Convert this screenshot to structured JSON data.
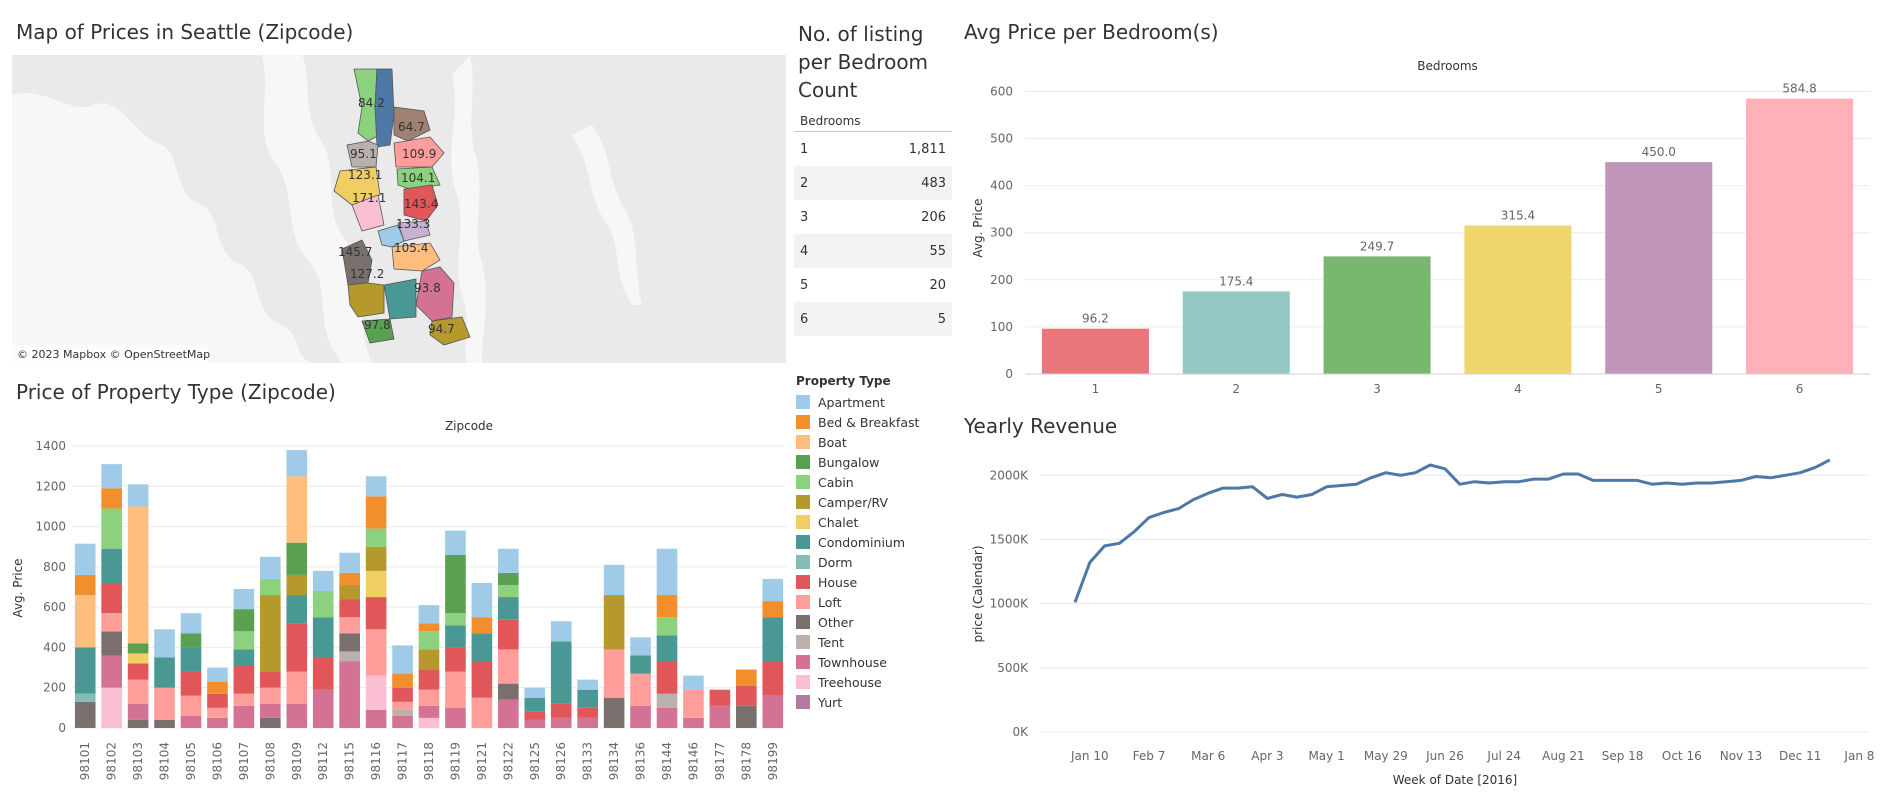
{
  "titles": {
    "map": "Map of Prices in Seattle (Zipcode)",
    "listing": [
      "No. of listing",
      "per Bedroom",
      "Count"
    ],
    "avg_bed": "Avg Price per Bedroom(s)",
    "prop_type": "Price of Property Type (Zipcode)",
    "revenue": "Yearly Revenue"
  },
  "map": {
    "attribution": "© 2023 Mapbox © OpenStreetMap",
    "labels": [
      "84.2",
      "64.7",
      "95.1",
      "109.9",
      "123.1",
      "104.1",
      "171.1",
      "143.4",
      "133.3",
      "145.7",
      "105.4",
      "127.2",
      "93.8",
      "97.8",
      "94.7"
    ],
    "colors": {
      "water": "#ffffff",
      "land": "#e8e8e8"
    }
  },
  "listing_table": {
    "header": "Bedrooms",
    "rows": [
      {
        "bedrooms": "1",
        "count": "1,811"
      },
      {
        "bedrooms": "2",
        "count": "483"
      },
      {
        "bedrooms": "3",
        "count": "206"
      },
      {
        "bedrooms": "4",
        "count": "55"
      },
      {
        "bedrooms": "5",
        "count": "20"
      },
      {
        "bedrooms": "6",
        "count": "5"
      }
    ]
  },
  "legend": {
    "title": "Property Type",
    "items": [
      {
        "name": "Apartment",
        "color": "#a0cbe8"
      },
      {
        "name": "Bed & Breakfast",
        "color": "#f28e2b"
      },
      {
        "name": "Boat",
        "color": "#ffbe7d"
      },
      {
        "name": "Bungalow",
        "color": "#59a14f"
      },
      {
        "name": "Cabin",
        "color": "#8cd17d"
      },
      {
        "name": "Camper/RV",
        "color": "#b6992d"
      },
      {
        "name": "Chalet",
        "color": "#f1ce63"
      },
      {
        "name": "Condominium",
        "color": "#499894"
      },
      {
        "name": "Dorm",
        "color": "#86bcb6"
      },
      {
        "name": "House",
        "color": "#e15759"
      },
      {
        "name": "Loft",
        "color": "#ff9d9a"
      },
      {
        "name": "Other",
        "color": "#79706e"
      },
      {
        "name": "Tent",
        "color": "#bab0ac"
      },
      {
        "name": "Townhouse",
        "color": "#d37295"
      },
      {
        "name": "Treehouse",
        "color": "#fabfd2"
      },
      {
        "name": "Yurt",
        "color": "#b07aa1"
      }
    ]
  },
  "chart_data": [
    {
      "type": "bar",
      "title": "Avg Price per Bedroom(s)",
      "top_label": "Bedrooms",
      "ylabel": "Avg. Price",
      "categories": [
        "1",
        "2",
        "3",
        "4",
        "5",
        "6"
      ],
      "values": [
        96.2,
        175.4,
        249.7,
        315.4,
        450.0,
        584.8
      ],
      "data_labels": [
        "96.2",
        "175.4",
        "249.7",
        "315.4",
        "450.0",
        "584.8"
      ],
      "colors": [
        "#e8767a",
        "#94c8c3",
        "#79b66f",
        "#f0d56e",
        "#c096b8",
        "#ffb1b8"
      ],
      "ylim": [
        0,
        620
      ],
      "yticks": [
        0,
        100,
        200,
        300,
        400,
        500,
        600
      ],
      "ytick_labels": [
        "0",
        "100",
        "200",
        "300",
        "400",
        "500",
        "600"
      ],
      "grid": true
    },
    {
      "type": "line",
      "title": "Yearly Revenue",
      "xlabel": "Week of Date [2016]",
      "ylabel": "price (Calendar)",
      "color": "#4e79a7",
      "x_tick_labels": [
        "Jan 10",
        "Feb 7",
        "Mar 6",
        "Apr 3",
        "May 1",
        "May 29",
        "Jun 26",
        "Jul 24",
        "Aug 21",
        "Sep 18",
        "Oct 16",
        "Nov 13",
        "Dec 11",
        "Jan 8"
      ],
      "yticks": [
        0,
        500000,
        1000000,
        1500000,
        2000000
      ],
      "ytick_labels": [
        "0K",
        "500K",
        "1000K",
        "1500K",
        "2000K"
      ],
      "ylim": [
        0,
        2150000
      ],
      "values": [
        1010000,
        1320000,
        1450000,
        1470000,
        1560000,
        1670000,
        1710000,
        1740000,
        1810000,
        1860000,
        1900000,
        1900000,
        1910000,
        1820000,
        1850000,
        1830000,
        1850000,
        1910000,
        1920000,
        1930000,
        1980000,
        2020000,
        2000000,
        2020000,
        2080000,
        2050000,
        1930000,
        1950000,
        1940000,
        1950000,
        1950000,
        1970000,
        1970000,
        2010000,
        2010000,
        1960000,
        1960000,
        1960000,
        1960000,
        1930000,
        1940000,
        1930000,
        1940000,
        1940000,
        1950000,
        1960000,
        1990000,
        1980000,
        2000000,
        2020000,
        2060000,
        2120000
      ],
      "grid": true
    },
    {
      "type": "bar",
      "stacked": true,
      "title": "Price of Property Type (Zipcode)",
      "top_label": "Zipcode",
      "ylabel": "Avg. Price",
      "categories": [
        "98101",
        "98102",
        "98103",
        "98104",
        "98105",
        "98106",
        "98107",
        "98108",
        "98109",
        "98112",
        "98115",
        "98116",
        "98117",
        "98118",
        "98119",
        "98121",
        "98122",
        "98125",
        "98126",
        "98133",
        "98134",
        "98136",
        "98144",
        "98146",
        "98177",
        "98178",
        "98199"
      ],
      "ylim": [
        -30,
        1420
      ],
      "yticks": [
        0,
        200,
        400,
        600,
        800,
        1000,
        1200,
        1400
      ],
      "ytick_labels": [
        "0",
        "200",
        "400",
        "600",
        "800",
        "1000",
        "1200",
        "1400"
      ],
      "stacks": [
        [
          [
            "Other",
            130
          ],
          [
            "Dorm",
            40
          ],
          [
            "Condominium",
            230
          ],
          [
            "Boat",
            260
          ],
          [
            "Bed & Breakfast",
            100
          ],
          [
            "Apartment",
            155
          ]
        ],
        [
          [
            "Treehouse",
            200
          ],
          [
            "Townhouse",
            160
          ],
          [
            "Other",
            120
          ],
          [
            "Loft",
            90
          ],
          [
            "House",
            150
          ],
          [
            "Condominium",
            170
          ],
          [
            "Cabin",
            200
          ],
          [
            "Bed & Breakfast",
            100
          ],
          [
            "Apartment",
            120
          ]
        ],
        [
          [
            "Other",
            40
          ],
          [
            "Townhouse",
            80
          ],
          [
            "Loft",
            120
          ],
          [
            "House",
            80
          ],
          [
            "Chalet",
            50
          ],
          [
            "Bungalow",
            50
          ],
          [
            "Boat",
            680
          ],
          [
            "Apartment",
            110
          ]
        ],
        [
          [
            "Other",
            40
          ],
          [
            "Loft",
            160
          ],
          [
            "Condominium",
            150
          ],
          [
            "Apartment",
            140
          ]
        ],
        [
          [
            "Townhouse",
            60
          ],
          [
            "Loft",
            100
          ],
          [
            "House",
            120
          ],
          [
            "Condominium",
            120
          ],
          [
            "Bungalow",
            70
          ],
          [
            "Apartment",
            100
          ]
        ],
        [
          [
            "Townhouse",
            50
          ],
          [
            "Loft",
            50
          ],
          [
            "House",
            70
          ],
          [
            "Bed & Breakfast",
            60
          ],
          [
            "Apartment",
            70
          ]
        ],
        [
          [
            "Townhouse",
            110
          ],
          [
            "Loft",
            60
          ],
          [
            "House",
            140
          ],
          [
            "Condominium",
            80
          ],
          [
            "Cabin",
            90
          ],
          [
            "Bungalow",
            110
          ],
          [
            "Apartment",
            100
          ]
        ],
        [
          [
            "Other",
            50
          ],
          [
            "Townhouse",
            70
          ],
          [
            "Loft",
            80
          ],
          [
            "House",
            80
          ],
          [
            "Camper/RV",
            380
          ],
          [
            "Cabin",
            80
          ],
          [
            "Apartment",
            110
          ]
        ],
        [
          [
            "Townhouse",
            120
          ],
          [
            "Loft",
            160
          ],
          [
            "House",
            240
          ],
          [
            "Condominium",
            140
          ],
          [
            "Camper/RV",
            100
          ],
          [
            "Bungalow",
            160
          ],
          [
            "Boat",
            330
          ],
          [
            "Apartment",
            130
          ]
        ],
        [
          [
            "Townhouse",
            190
          ],
          [
            "House",
            160
          ],
          [
            "Condominium",
            200
          ],
          [
            "Cabin",
            130
          ],
          [
            "Apartment",
            100
          ]
        ],
        [
          [
            "Townhouse",
            330
          ],
          [
            "Tent",
            50
          ],
          [
            "Other",
            90
          ],
          [
            "Loft",
            80
          ],
          [
            "House",
            90
          ],
          [
            "Camper/RV",
            70
          ],
          [
            "Bed & Breakfast",
            60
          ],
          [
            "Apartment",
            100
          ]
        ],
        [
          [
            "Townhouse",
            90
          ],
          [
            "Treehouse",
            170
          ],
          [
            "Loft",
            230
          ],
          [
            "House",
            160
          ],
          [
            "Chalet",
            130
          ],
          [
            "Camper/RV",
            120
          ],
          [
            "Cabin",
            90
          ],
          [
            "Bed & Breakfast",
            160
          ],
          [
            "Apartment",
            100
          ]
        ],
        [
          [
            "Townhouse",
            60
          ],
          [
            "Tent",
            30
          ],
          [
            "Loft",
            40
          ],
          [
            "House",
            70
          ],
          [
            "Bed & Breakfast",
            70
          ],
          [
            "Apartment",
            140
          ]
        ],
        [
          [
            "Treehouse",
            50
          ],
          [
            "Townhouse",
            60
          ],
          [
            "Loft",
            80
          ],
          [
            "House",
            100
          ],
          [
            "Camper/RV",
            100
          ],
          [
            "Cabin",
            90
          ],
          [
            "Bed & Breakfast",
            40
          ],
          [
            "Apartment",
            90
          ]
        ],
        [
          [
            "Townhouse",
            100
          ],
          [
            "Loft",
            180
          ],
          [
            "House",
            120
          ],
          [
            "Condominium",
            110
          ],
          [
            "Cabin",
            60
          ],
          [
            "Bungalow",
            290
          ],
          [
            "Apartment",
            120
          ]
        ],
        [
          [
            "Loft",
            150
          ],
          [
            "House",
            180
          ],
          [
            "Condominium",
            140
          ],
          [
            "Bed & Breakfast",
            80
          ],
          [
            "Apartment",
            170
          ]
        ],
        [
          [
            "Townhouse",
            140
          ],
          [
            "Other",
            80
          ],
          [
            "Loft",
            170
          ],
          [
            "House",
            150
          ],
          [
            "Condominium",
            110
          ],
          [
            "Cabin",
            60
          ],
          [
            "Bungalow",
            60
          ],
          [
            "Apartment",
            120
          ]
        ],
        [
          [
            "Townhouse",
            40
          ],
          [
            "House",
            40
          ],
          [
            "Condominium",
            70
          ],
          [
            "Apartment",
            50
          ]
        ],
        [
          [
            "Townhouse",
            50
          ],
          [
            "House",
            70
          ],
          [
            "Condominium",
            310
          ],
          [
            "Apartment",
            100
          ]
        ],
        [
          [
            "Townhouse",
            50
          ],
          [
            "House",
            50
          ],
          [
            "Condominium",
            90
          ],
          [
            "Apartment",
            50
          ]
        ],
        [
          [
            "Other",
            150
          ],
          [
            "Loft",
            240
          ],
          [
            "Camper/RV",
            270
          ],
          [
            "Apartment",
            150
          ]
        ],
        [
          [
            "Townhouse",
            110
          ],
          [
            "Loft",
            160
          ],
          [
            "Condominium",
            90
          ],
          [
            "Apartment",
            90
          ]
        ],
        [
          [
            "Townhouse",
            100
          ],
          [
            "Tent",
            70
          ],
          [
            "House",
            160
          ],
          [
            "Condominium",
            130
          ],
          [
            "Cabin",
            90
          ],
          [
            "Bed & Breakfast",
            110
          ],
          [
            "Apartment",
            230
          ]
        ],
        [
          [
            "Townhouse",
            50
          ],
          [
            "Loft",
            140
          ],
          [
            "Apartment",
            70
          ]
        ],
        [
          [
            "Townhouse",
            110
          ],
          [
            "House",
            80
          ]
        ],
        [
          [
            "Other",
            110
          ],
          [
            "House",
            100
          ],
          [
            "Bed & Breakfast",
            80
          ]
        ],
        [
          [
            "Townhouse",
            160
          ],
          [
            "House",
            170
          ],
          [
            "Condominium",
            220
          ],
          [
            "Bed & Breakfast",
            80
          ],
          [
            "Apartment",
            110
          ]
        ]
      ]
    }
  ]
}
